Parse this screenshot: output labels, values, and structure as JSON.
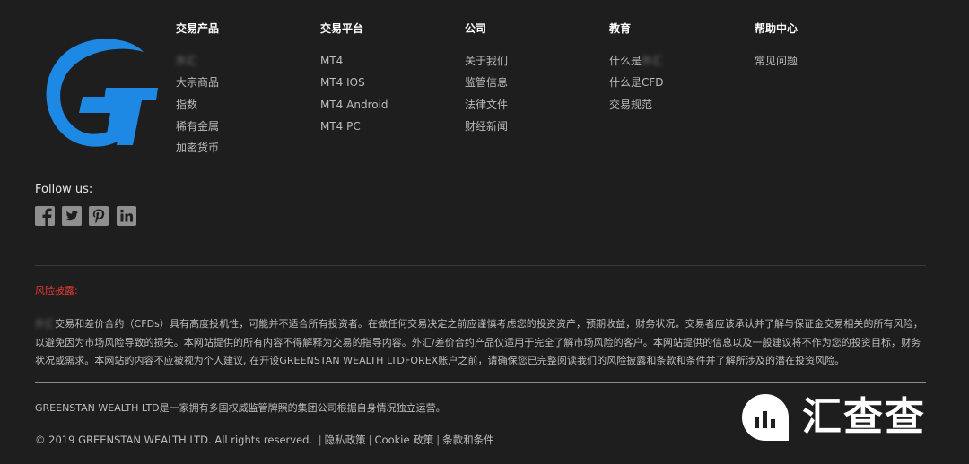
{
  "nav": {
    "columns": [
      {
        "title": "交易产品",
        "items": [
          {
            "label": "外汇",
            "blurred": true
          },
          {
            "label": "大宗商品"
          },
          {
            "label": "指数"
          },
          {
            "label": "稀有金属"
          },
          {
            "label": "加密货币"
          }
        ]
      },
      {
        "title": "交易平台",
        "items": [
          {
            "label": "MT4"
          },
          {
            "label": "MT4 IOS"
          },
          {
            "label": "MT4 Android"
          },
          {
            "label": "MT4 PC"
          }
        ]
      },
      {
        "title": "公司",
        "items": [
          {
            "label": "关于我们"
          },
          {
            "label": "监管信息"
          },
          {
            "label": "法律文件"
          },
          {
            "label": "财经新闻"
          }
        ]
      },
      {
        "title": "教育",
        "items": [
          {
            "label": "什么是",
            "blurred_suffix": "外汇"
          },
          {
            "label": "什么是CFD"
          },
          {
            "label": "交易规范"
          }
        ]
      },
      {
        "title": "帮助中心",
        "items": [
          {
            "label": "常见问题"
          }
        ]
      }
    ]
  },
  "logo": {
    "letters": "GT",
    "color": "#1e88e5"
  },
  "follow": {
    "label": "Follow us:",
    "icons": [
      "facebook-icon",
      "twitter-icon",
      "pinterest-icon",
      "linkedin-icon"
    ],
    "icon_color": "#8f8f8f"
  },
  "risk": {
    "title": "风险披露:",
    "title_color": "#e53935",
    "blurred_prefix": "外汇",
    "body": "交易和差价合约（CFDs）具有高度投机性，可能并不适合所有投资者。在做任何交易决定之前应谨慎考虑您的投资资产，预期收益，财务状况。交易者应该承认并了解与保证金交易相关的所有风险，以避免因为市场风险导致的损失。本网站提供的所有内容不得解释为交易的指导内容。外汇/差价合约产品仅适用于完全了解市场风险的客户。本网站提供的信息以及一般建议将不作为您的投资目标，财务状况或需求。本网站的内容不应被视为个人建议, 在开设GREENSTAN WEALTH LTDFOREX账户之前，请确保您已完整阅读我们的风险披露和条款和条件并了解所涉及的潜在投资风险。"
  },
  "footer": {
    "company_desc": "GREENSTAN WEALTH LTD是一家拥有多国权威监管牌照的集团公司根据自身情况独立运营。",
    "copyright": "© 2019 GREENSTAN WEALTH LTD. All rights reserved.",
    "links": [
      "隐私政策",
      "Cookie 政策",
      "条款和条件"
    ],
    "separator": "|"
  },
  "watermark": {
    "text": "汇查查"
  }
}
